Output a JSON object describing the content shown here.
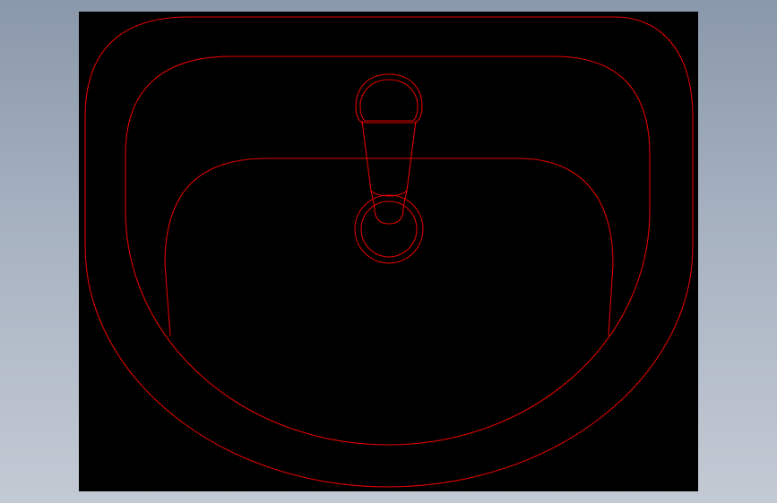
{
  "colors": {
    "background_gradient_top": "#8a98ab",
    "background_gradient_bottom": "#c3cad4",
    "viewport_background": "#000000",
    "line_color": "#e00000"
  },
  "drawing": {
    "subject": "washbasin-plan-view",
    "entities": [
      "basin-outer-rim",
      "basin-inner-rim",
      "bowl-outline",
      "tap-lever-outer",
      "tap-lever-inner",
      "tap-body-left-edge",
      "tap-body-right-edge",
      "tap-base-outer-ring",
      "tap-base-inner-ring",
      "tap-stem-bottom"
    ]
  }
}
